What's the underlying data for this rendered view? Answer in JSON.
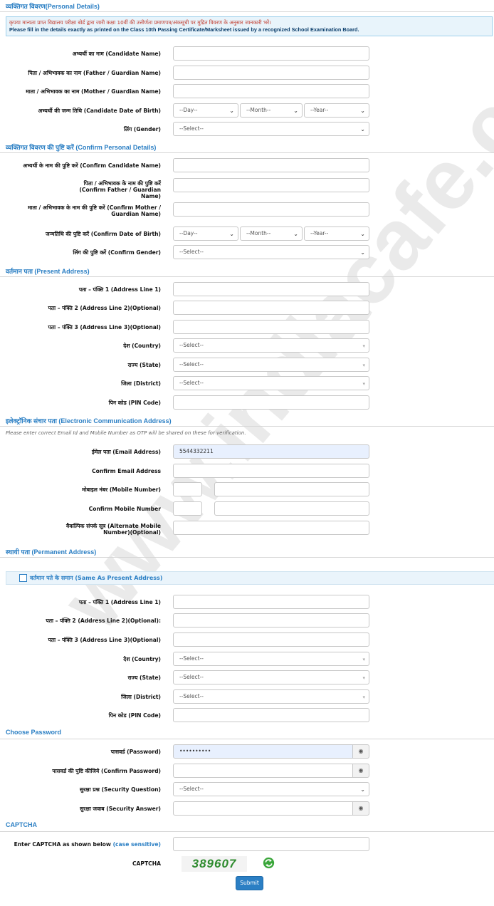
{
  "sections": {
    "personal": "व्यक्तिगत विवरण(Personal Details)",
    "confirm": "व्यक्तिगत विवरण की पुष्टि करें (Confirm Personal Details)",
    "present": "वर्तमान पता (Present Address)",
    "electronic": "इलेक्ट्रॉनिक संचार पता (Electronic Communication Address)",
    "permanent": "स्थायी पता (Permanent Address)",
    "password": "Choose Password",
    "captcha": "CAPTCHA"
  },
  "notice": {
    "hindi": "कृपया मान्यता प्राप्त विद्यालय परीक्षा बोर्ड द्वारा जारी कक्षा 10वीं की उत्तीर्णता प्रमाणपत्र/अंकसूची पर मुद्रित विवरण के अनुसार जानकारी भरें।",
    "english": "Please fill in the details exactly as printed on the Class 10th Passing Certificate/Marksheet issued by a recognized School Examination Board."
  },
  "labels": {
    "name": "अभ्यर्थी का नाम (Candidate Name)",
    "father": "पिता / अभिभावक का नाम (Father / Guardian Name)",
    "mother": "माता / अभिभावक का नाम (Mother / Guardian Name)",
    "dob": "अभ्यर्थी की जन्म तिथि (Candidate Date of Birth)",
    "gender": "लिंग (Gender)",
    "c_name": "अभ्यर्थी के नाम की पुष्टि करें (Confirm Candidate Name)",
    "c_father": "पिता / अभिभावक के नाम की पुष्टि करें (Confirm Father / Guardian Name)",
    "c_mother": "माता / अभिभावक के नाम की पुष्टि करें (Confirm Mother / Guardian Name)",
    "c_dob": "जन्मतिथि की पुष्टि करें (Confirm Date of Birth)",
    "c_gender": "लिंग की पुष्टि करें (Confirm Gender)",
    "addr1": "पता – पंक्ति 1 (Address Line 1)",
    "addr2": "पता – पंक्ति 2 (Address Line 2)(Optional)",
    "addr3": "पता – पंक्ति 3 (Address Line 3)(Optional)",
    "country": "देश (Country)",
    "state": "राज्य (State)",
    "district": "जिला (District)",
    "pin": "पिन कोड (PIN Code)",
    "email": "ईमेल पता (Email Address)",
    "c_email": "Confirm Email Address",
    "mobile": "मोबाइल नंबर (Mobile Number)",
    "c_mobile": "Confirm Mobile Number",
    "alt_mobile": "वैकल्पिक संपर्क सूत्र (Alternate Mobile Number)(Optional)",
    "p_addr2": "पता – पंक्ति 2 (Address Line 2)(Optional):",
    "p_district": "जिला (District)",
    "password": "पासवर्ड (Password)",
    "c_password": "पासवर्ड की पुष्टि कीजिये (Confirm Password)",
    "sec_q": "सुरक्षा प्रश्न (Security Question)",
    "sec_a": "सुरक्षा जवाब (Security Answer)",
    "captcha_enter": "Enter CAPTCHA as shown below",
    "case_sensitive": "(case sensitive)",
    "captcha": "CAPTCHA"
  },
  "selects": {
    "day": "--Day--",
    "month": "--Month--",
    "year": "--Year--",
    "select": "--Select--"
  },
  "values": {
    "email": "5544332211",
    "password": "••••••••••",
    "captcha": "389607"
  },
  "note": "Please enter correct Email Id and Mobile Number as OTP will be shared on these for verification.",
  "same_as_present": "वर्तमान पते के समान (Same As Present Address)",
  "submit": "Submit",
  "watermark": "www.indiacafe.com",
  "colors": {
    "accent": "#2b7fc4",
    "captcha": "#2e8b2e",
    "notice_bg": "#e8f4fb"
  }
}
